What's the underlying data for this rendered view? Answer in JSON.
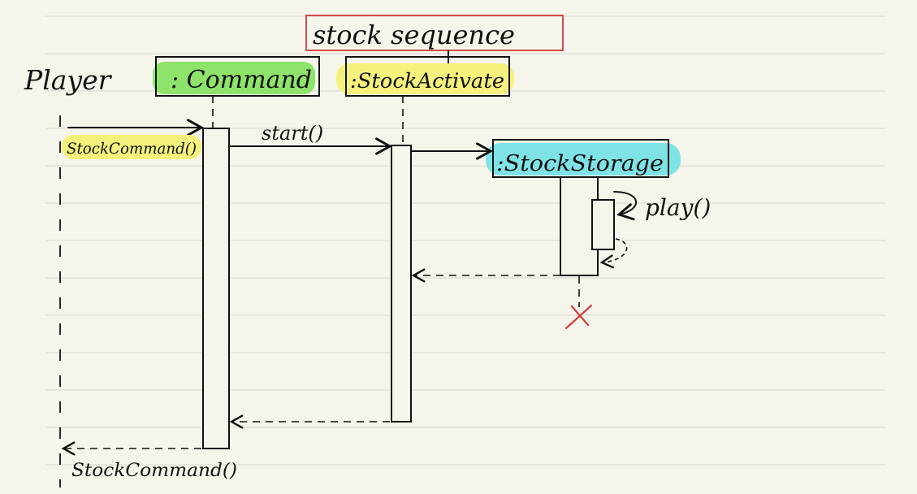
{
  "diagram": {
    "title": "stock sequence",
    "actor": "Player",
    "participants": [
      {
        "id": "command",
        "label": ": Command",
        "highlight": "#8ee46b"
      },
      {
        "id": "activate",
        "label": ":StockActivate",
        "highlight": "#f4f27c"
      },
      {
        "id": "storage",
        "label": ":StockStorage",
        "highlight": "#7fe3e6"
      }
    ],
    "messages": [
      {
        "from": "player",
        "to": "command",
        "label": "StockCommand()",
        "kind": "call",
        "highlight": "#f4f27c"
      },
      {
        "from": "command",
        "to": "activate",
        "label": "start()",
        "kind": "call"
      },
      {
        "from": "activate",
        "to": "storage",
        "label": "",
        "kind": "create"
      },
      {
        "from": "storage",
        "to": "storage",
        "label": "play()",
        "kind": "self"
      },
      {
        "from": "storage",
        "to": "activate",
        "label": "",
        "kind": "return"
      },
      {
        "from": "activate",
        "to": "command",
        "label": "",
        "kind": "return"
      },
      {
        "from": "command",
        "to": "player",
        "label": "StockCommand()",
        "kind": "return"
      }
    ],
    "colors": {
      "ink": "#111111",
      "paper": "#f6f5ec",
      "title_box": "#d23a3a",
      "destroy_mark": "#d23a3a"
    }
  }
}
